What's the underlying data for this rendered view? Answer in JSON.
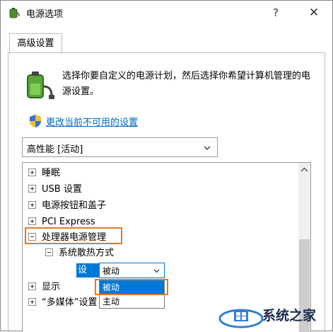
{
  "window": {
    "title": "电源选项",
    "help_label": "?",
    "close_label": "✕",
    "icon": "power-options-icon"
  },
  "tab": {
    "label": "高级设置"
  },
  "description": "选择你要自定义的电源计划，然后选择你希望计算机管理的电源设置。",
  "change_link": "更改当前不可用的设置",
  "plan_select": {
    "value": "高性能 [活动]"
  },
  "tree": {
    "items": [
      {
        "label": "睡眠",
        "state": "collapsed"
      },
      {
        "label": "USB 设置",
        "state": "collapsed"
      },
      {
        "label": "电源按钮和盖子",
        "state": "collapsed"
      },
      {
        "label": "PCI Express",
        "state": "collapsed"
      },
      {
        "label": "处理器电源管理",
        "state": "expanded"
      },
      {
        "label": "系统散热方式",
        "state": "expanded"
      },
      {
        "label": "显示",
        "state": "collapsed"
      },
      {
        "label": "“多媒体”设置",
        "state": "collapsed"
      }
    ],
    "setting_label": "设置:",
    "setting_value": "被动",
    "options": [
      "被动",
      "主动"
    ],
    "selected_option": "被动"
  },
  "watermark": {
    "text": "系统之家"
  },
  "colors": {
    "accent": "#0078d7",
    "highlight_box": "#e07b27",
    "link": "#0066cc"
  }
}
